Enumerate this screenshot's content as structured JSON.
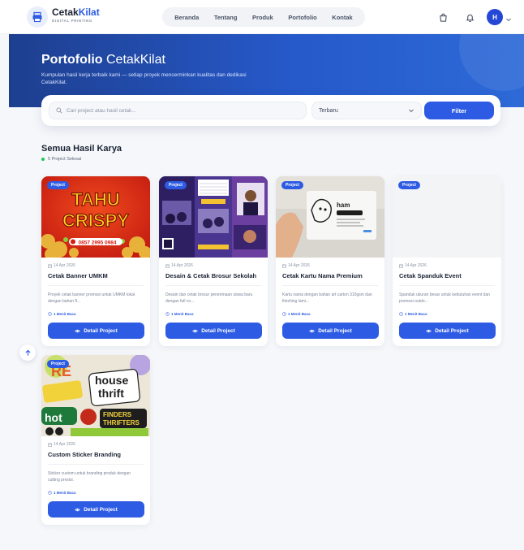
{
  "brand": {
    "name_main": "Cetak",
    "name_accent": "Kilat",
    "subtitle": "DIGITAL PRINTING"
  },
  "nav": {
    "links": [
      "Beranda",
      "Tentang",
      "Produk",
      "Portofolio",
      "Kontak"
    ]
  },
  "user": {
    "avatar_initial": "H"
  },
  "hero": {
    "title_bold": "Portofolio",
    "title_light": "CetakKilat",
    "description": "Kumpulan hasil kerja terbaik kami — setiap proyek mencerminkan kualitas dan dedikasi CetakKilat."
  },
  "filters": {
    "search_placeholder": "Cari project atau hasil cetak...",
    "sort_value": "Terbaru",
    "filter_label": "Filter"
  },
  "section": {
    "title": "Semua Hasil Karya",
    "count_text": "5 Project Selesai"
  },
  "cards": [
    {
      "badge": "Project",
      "date": "14 Apr 2026",
      "title": "Cetak Banner UMKM",
      "description": "Proyek cetak banner promosi untuk UMKM lokal dengan bahan fl...",
      "read_time": "1 Menit Baca",
      "button": "Detail Project",
      "image_text_1": "TAHU",
      "image_text_2": "CRISPY",
      "image_phone": "0857 2995 0984"
    },
    {
      "badge": "Project",
      "date": "14 Apr 2026",
      "title": "Desain & Cetak Brosur Sekolah",
      "description": "Desain dan cetak brosur penerimaan siswa baru dengan full co...",
      "read_time": "1 Menit Baca",
      "button": "Detail Project"
    },
    {
      "badge": "Project",
      "date": "14 Apr 2026",
      "title": "Cetak Kartu Nama Premium",
      "description": "Kartu nama dengan bahan art carton 310gsm dan finishing lami...",
      "read_time": "1 Menit Baca",
      "button": "Detail Project",
      "image_text_1": "ham"
    },
    {
      "badge": "Project",
      "date": "14 Apr 2026",
      "title": "Cetak Spanduk Event",
      "description": "Spanduk ukuran besar untuk kebutuhan event dan promosi outdo...",
      "read_time": "1 Menit Baca",
      "button": "Detail Project"
    },
    {
      "badge": "Project",
      "date": "14 Apr 2026",
      "title": "Custom Sticker Branding",
      "description": "Sticker custom untuk branding produk dengan cutting presisi.",
      "read_time": "1 Menit Baca",
      "button": "Detail Project",
      "image_text_1": "house",
      "image_text_2": "thrift",
      "image_text_3": "hot",
      "image_text_4": "FINDERS",
      "image_text_5": "THRIFTERS"
    }
  ],
  "colors": {
    "primary": "#2d5be3",
    "hero_dark": "#1e3f8f",
    "hero_light": "#2d6ad8",
    "background": "#f5f7fa",
    "success": "#22c55e"
  },
  "icons": [
    "printer-icon",
    "bag-icon",
    "bell-icon",
    "chevron-down-icon",
    "search-icon",
    "calendar-icon",
    "clock-icon",
    "eye-icon",
    "arrow-up-icon"
  ]
}
